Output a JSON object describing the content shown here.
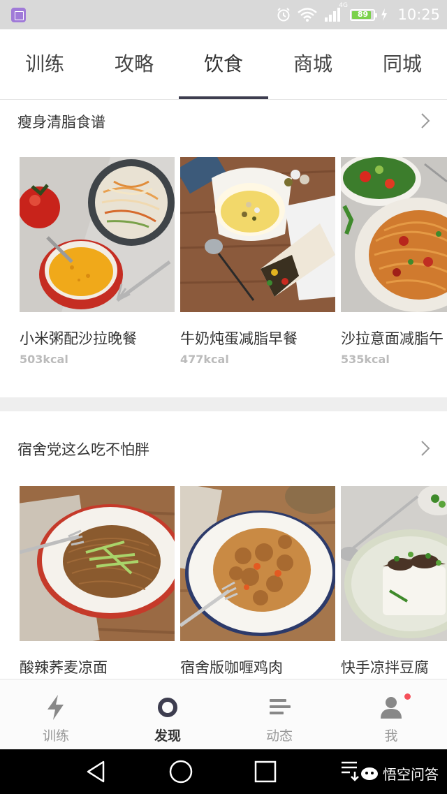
{
  "status_bar": {
    "network_type": "4G",
    "battery_percent": 89,
    "battery_text": "89",
    "time": "10:25"
  },
  "top_tabs": [
    {
      "label": "训练",
      "active": false
    },
    {
      "label": "攻略",
      "active": false
    },
    {
      "label": "饮食",
      "active": true
    },
    {
      "label": "商城",
      "active": false
    },
    {
      "label": "同城",
      "active": false
    }
  ],
  "sections": [
    {
      "title": "瘦身清脂食谱",
      "cards": [
        {
          "title": "小米粥配沙拉晚餐",
          "kcal": "503kcal"
        },
        {
          "title": "牛奶炖蛋减脂早餐",
          "kcal": "477kcal"
        },
        {
          "title": "沙拉意面减脂午",
          "kcal": "535kcal"
        }
      ]
    },
    {
      "title": "宿舍党这么吃不怕胖",
      "cards": [
        {
          "title": "酸辣荞麦凉面"
        },
        {
          "title": "宿舍版咖喱鸡肉"
        },
        {
          "title": "快手凉拌豆腐"
        }
      ]
    }
  ],
  "bottom_nav": [
    {
      "label": "训练",
      "icon": "lightning-icon",
      "active": false
    },
    {
      "label": "发现",
      "icon": "ring-icon",
      "active": true
    },
    {
      "label": "动态",
      "icon": "feed-lines-icon",
      "active": false
    },
    {
      "label": "我",
      "icon": "person-icon",
      "active": false,
      "badge": true
    }
  ],
  "watermark": {
    "text": "悟空问答"
  },
  "colors": {
    "accent": "#3d3d4f",
    "badge": "#f5505a",
    "battery": "#7bd14b",
    "divider": "#eeeeee"
  }
}
